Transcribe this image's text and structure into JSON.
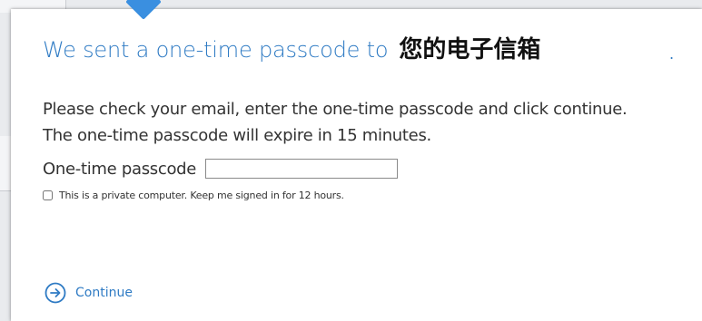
{
  "dialog": {
    "title": "We sent a one-time passcode to",
    "mailbox": "您的电子信箱",
    "trailing_dot": ".",
    "instructions": [
      "Please check your email, enter the one-time passcode and click continue.",
      "The one-time passcode will expire in 15 minutes."
    ],
    "passcode": {
      "label": "One-time passcode",
      "value": "",
      "placeholder": ""
    },
    "keep_signed_in": {
      "label": "This is a private computer. Keep me signed in for 12 hours.",
      "checked": false
    },
    "continue": {
      "label": "Continue",
      "icon": "arrow-right-circle-icon"
    }
  },
  "colors": {
    "accent": "#2f7bc4",
    "pointer": "#3a8fe0",
    "text": "#333333"
  }
}
